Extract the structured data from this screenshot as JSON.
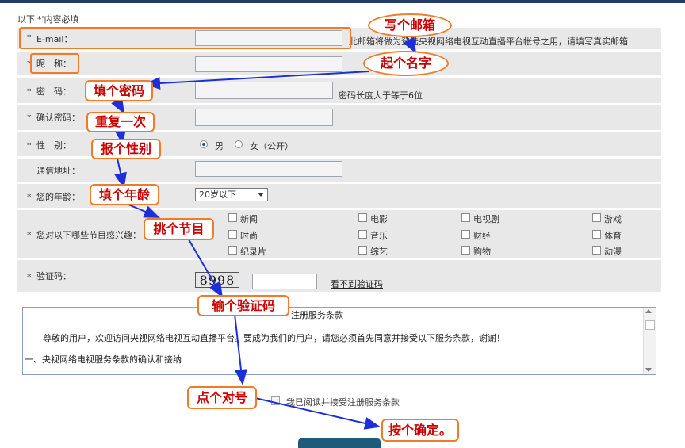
{
  "note": "以下'*'内容必填",
  "email": {
    "label": "E-mail：",
    "hint": "此邮箱将做为登陆央视网络电视互动直播平台帐号之用，请填写真实邮箱"
  },
  "nickname": {
    "label": "昵　称："
  },
  "password": {
    "label": "密　码：",
    "hint": "密码长度大于等于6位"
  },
  "confirm": {
    "label": "确认密码："
  },
  "gender": {
    "label": "性　别：",
    "male": "男",
    "female": "女（公开）",
    "selected": "男"
  },
  "address": {
    "label": "通信地址："
  },
  "age": {
    "label": "您的年龄：",
    "value": "20岁以下"
  },
  "interests": {
    "label": "您对以下哪些节目感兴趣：",
    "items": [
      "新闻",
      "电影",
      "电视剧",
      "游戏",
      "时尚",
      "音乐",
      "财经",
      "体育",
      "纪录片",
      "综艺",
      "购物",
      "动漫"
    ]
  },
  "captcha": {
    "label": "验证码：",
    "code": "8998",
    "link": "看不到验证码"
  },
  "terms": {
    "title": "注册服务条款",
    "p1": "尊敬的用户，欢迎访问央视网络电视互动直播平台。要成为我们的用户，请您必须首先同意并接受以下服务条款，谢谢！",
    "h1": "一、央视网络电视服务条款的确认和接纳"
  },
  "agree": {
    "label": "我已阅读并接受注册服务条款"
  },
  "callouts": {
    "email": "写个邮箱",
    "name": "起个名字",
    "password": "填个密码",
    "repeat": "重复一次",
    "gender": "报个性别",
    "age": "填个年龄",
    "program": "挑个节目",
    "captcha": "输个验证码",
    "check": "点个对号",
    "confirm": "按个确定。"
  },
  "colors": {
    "accent": "#f07b2a",
    "callout_text": "#cc0000",
    "arrow": "#1d2fd8",
    "row_bg": "#e8e8e8"
  }
}
